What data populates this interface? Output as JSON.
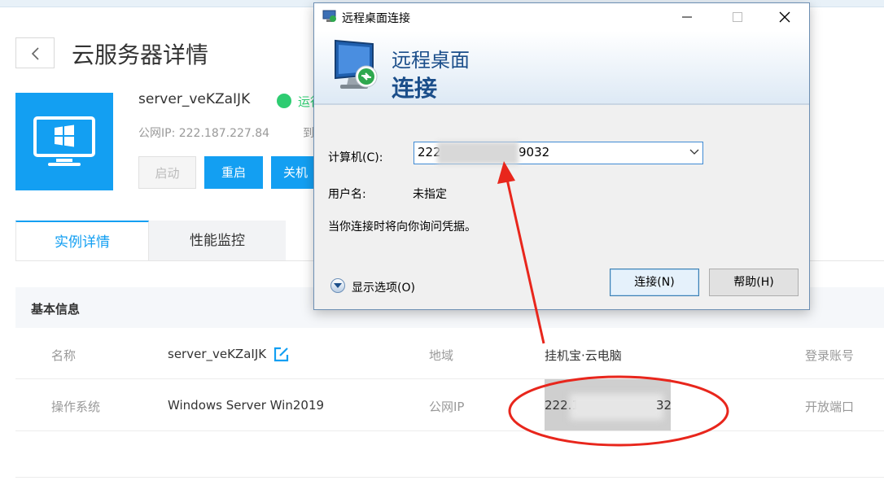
{
  "page": {
    "title": "云服务器详情"
  },
  "server": {
    "name": "server_veKZaIJK",
    "status": "运行",
    "public_ip_label": "公网IP: 222.187.227.84",
    "expire_label": "到"
  },
  "actions": {
    "start": "启动",
    "restart": "重启",
    "shutdown": "关机"
  },
  "tabs": [
    {
      "label": "实例详情"
    },
    {
      "label": "性能监控"
    }
  ],
  "basic_info": {
    "section_title": "基本信息",
    "rows": [
      {
        "label1": "名称",
        "value1": "server_veKZaIJK",
        "label2": "地域",
        "value2": "挂机宝·云电脑",
        "label3": "登录账号"
      },
      {
        "label1": "操作系统",
        "value1": "Windows Server Win2019",
        "label2": "公网IP",
        "value2": "222.1",
        "value2_tail": "32",
        "label3": "开放端口"
      }
    ]
  },
  "rdp_dialog": {
    "window_title": "远程桌面连接",
    "banner_line1": "远程桌面",
    "banner_line2": "连接",
    "computer_label": "计算机(C):",
    "computer_value_prefix": "222",
    "computer_value_suffix": "9032",
    "username_label": "用户名:",
    "username_value": "未指定",
    "credentials_note": "当你连接时将向你询问凭据。",
    "show_options": "显示选项(O)",
    "connect_button": "连接(N)",
    "help_button": "帮助(H)"
  },
  "colors": {
    "primary": "#139ff2",
    "status_green": "#2ecc71",
    "annotation_red": "#e8261c",
    "dialog_title": "#1b4e8a"
  }
}
